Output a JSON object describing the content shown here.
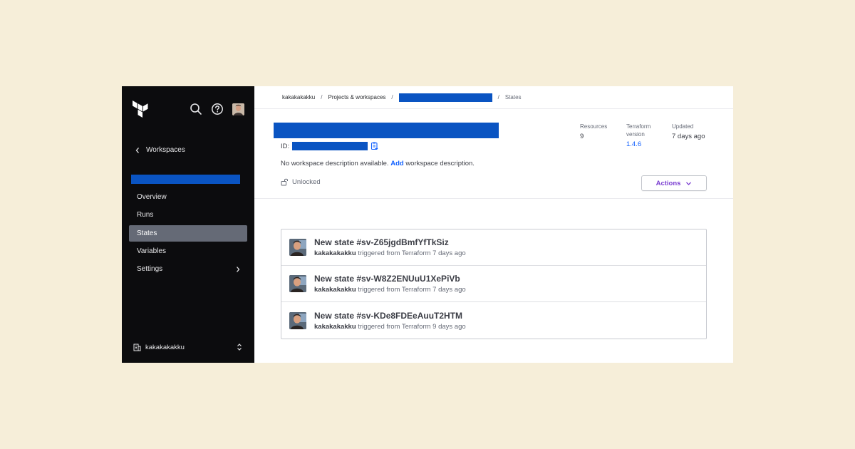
{
  "sidebar": {
    "back_label": "Workspaces",
    "nav": [
      {
        "label": "Overview"
      },
      {
        "label": "Runs"
      },
      {
        "label": "States",
        "active": true
      },
      {
        "label": "Variables"
      },
      {
        "label": "Settings",
        "has_chevron": true
      }
    ],
    "org_name": "kakakakakku"
  },
  "breadcrumb": {
    "org": "kakakakakku",
    "projects": "Projects & workspaces",
    "separator": "/",
    "current": "States"
  },
  "workspace": {
    "id_label": "ID:",
    "description_prefix": "No workspace description available.",
    "description_link": "Add",
    "description_suffix": "workspace description.",
    "lock_status": "Unlocked",
    "actions_label": "Actions"
  },
  "meta": {
    "resources_label": "Resources",
    "resources_value": "9",
    "tf_label_1": "Terraform",
    "tf_label_2": "version",
    "tf_value": "1.4.6",
    "updated_label": "Updated",
    "updated_value": "7 days ago"
  },
  "states": [
    {
      "title": "New state #sv-Z65jgdBmfYfTkSiz",
      "user": "kakakakakku",
      "triggered": "triggered from Terraform 7 days ago"
    },
    {
      "title": "New state #sv-W8Z2ENUuU1XePiVb",
      "user": "kakakakakku",
      "triggered": "triggered from Terraform 7 days ago"
    },
    {
      "title": "New state #sv-KDe8FDEeAuuT2HTM",
      "user": "kakakakakku",
      "triggered": "triggered from Terraform 9 days ago"
    }
  ],
  "colors": {
    "page_background": "#f6eed9",
    "sidebar_background": "#0c0c0e",
    "redaction": "#0a54c2",
    "link": "#1060ff",
    "action_purple": "#7b3fd1",
    "active_nav": "#656a76"
  },
  "icons": {
    "logo": "terraform-logo",
    "search": "search-icon",
    "help": "help-icon",
    "copy": "copy-icon",
    "lock": "unlock-icon"
  }
}
